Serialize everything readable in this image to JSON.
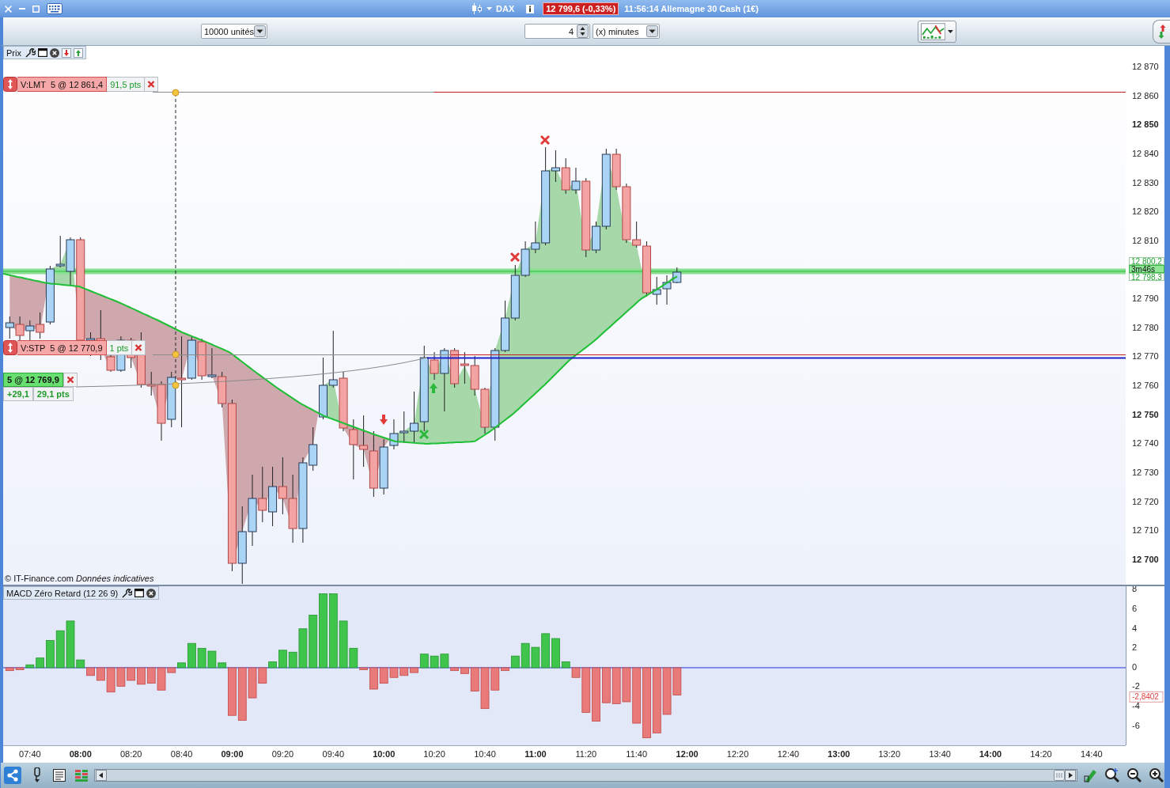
{
  "title_bar": {
    "instrument": "DAX",
    "price_badge": "12 799,6 (-0,33%)",
    "info": "11:56:14 Allemagne 30 Cash (1€)"
  },
  "toolbar": {
    "quantity": "10000 unités",
    "period": "4",
    "unit": "(x) minutes"
  },
  "price_panel": {
    "title": "Prix",
    "orders": [
      {
        "label": "V:LMT  5 @ 12 861,4",
        "distance": "91,5 pts"
      },
      {
        "label": "V:STP  5 @ 12 770,9",
        "distance": "1 pts"
      }
    ],
    "position": {
      "label": "5 @ 12 769,9",
      "gain": "+29,1",
      "points": "29,1 pts"
    },
    "axis": [
      {
        "kind": "tick",
        "label": "12 870",
        "major": false
      },
      {
        "kind": "tick",
        "label": "12 860",
        "major": false
      },
      {
        "kind": "tick",
        "label": "12 850",
        "major": true
      },
      {
        "kind": "tick",
        "label": "12 840",
        "major": false
      },
      {
        "kind": "tick",
        "label": "12 830",
        "major": false
      },
      {
        "kind": "tick",
        "label": "12 820",
        "major": false
      },
      {
        "kind": "tick",
        "label": "12 810",
        "major": false
      },
      {
        "kind": "tags",
        "tags": [
          {
            "kind": "price",
            "text": "12 800,2"
          },
          {
            "kind": "timer",
            "text": "3m46s"
          },
          {
            "kind": "price",
            "text": "12 798,3"
          }
        ]
      },
      {
        "kind": "tick",
        "label": "12 790",
        "major": false
      },
      {
        "kind": "tick",
        "label": "12 780",
        "major": false
      },
      {
        "kind": "tick",
        "label": "12 770",
        "major": false
      },
      {
        "kind": "tick",
        "label": "12 760",
        "major": false
      },
      {
        "kind": "tick",
        "label": "12 750",
        "major": true
      },
      {
        "kind": "tick",
        "label": "12 740",
        "major": false
      },
      {
        "kind": "tick",
        "label": "12 730",
        "major": false
      },
      {
        "kind": "tick",
        "label": "12 720",
        "major": false
      },
      {
        "kind": "tick",
        "label": "12 710",
        "major": false
      },
      {
        "kind": "tick",
        "label": "12 700",
        "major": true
      }
    ],
    "note": "© IT-Finance.com *Données indicatives*"
  },
  "macd_panel": {
    "value_tag": "-2,8402",
    "chart_data": {
      "type": "bar",
      "title": "MACD Zéro Retard (12 26 9)",
      "x": [
        452,
        456,
        460,
        464,
        468,
        472,
        476,
        480,
        484,
        488,
        492,
        496,
        500,
        504,
        508,
        512,
        516,
        520,
        524,
        528,
        532,
        536,
        540,
        544,
        548,
        552,
        556,
        560,
        564,
        568,
        572,
        576,
        580,
        584,
        588,
        592,
        596,
        600,
        604,
        608,
        612,
        616,
        620,
        624,
        628,
        632,
        636,
        640,
        644,
        648,
        652,
        656,
        660,
        664,
        668,
        672,
        676,
        680,
        684,
        688,
        692,
        696,
        700,
        704,
        708,
        712,
        716
      ],
      "values": [
        -0.3,
        -0.2,
        0.3,
        1,
        2.8,
        3.8,
        4.8,
        0.8,
        -0.8,
        -1.3,
        -2.5,
        -1.9,
        -1.3,
        -1.7,
        -1.6,
        -2.3,
        -0.5,
        0.5,
        2.5,
        2,
        1.7,
        0.5,
        -4.9,
        -5.4,
        -3.1,
        -1.6,
        0.6,
        1.8,
        1.6,
        4,
        5.4,
        7.6,
        7.6,
        4.8,
        2,
        -0.2,
        -2.2,
        -1.6,
        -1,
        -0.8,
        -0.5,
        1.4,
        1.2,
        1.4,
        -0.3,
        -0.6,
        -2.4,
        -4.2,
        -2.3,
        -0.3,
        1.2,
        2.5,
        2.1,
        3.5,
        3,
        0.6,
        -1,
        -4.6,
        -5.5,
        -3.6,
        -3.7,
        -3.5,
        -5.7,
        -7.2,
        -6.7,
        -4.8,
        -2.8
      ],
      "xlim": [
        449.4,
        893.5
      ],
      "ylim": [
        -7.97,
        8.37
      ],
      "xticks": [
        {
          "value": 460,
          "label": "07:40"
        },
        {
          "value": 480,
          "label": "08:00"
        },
        {
          "value": 500,
          "label": "08:20"
        },
        {
          "value": 520,
          "label": "08:40"
        },
        {
          "value": 540,
          "label": "09:00"
        },
        {
          "value": 560,
          "label": "09:20"
        },
        {
          "value": 580,
          "label": "09:40"
        },
        {
          "value": 600,
          "label": "10:00"
        },
        {
          "value": 620,
          "label": "10:20"
        },
        {
          "value": 640,
          "label": "10:40"
        },
        {
          "value": 660,
          "label": "11:00"
        },
        {
          "value": 680,
          "label": "11:20"
        },
        {
          "value": 700,
          "label": "11:40"
        },
        {
          "value": 720,
          "label": "12:00"
        },
        {
          "value": 740,
          "label": "12:20"
        },
        {
          "value": 760,
          "label": "12:40"
        },
        {
          "value": 780,
          "label": "13:00"
        },
        {
          "value": 800,
          "label": "13:20"
        },
        {
          "value": 820,
          "label": "13:40"
        },
        {
          "value": 840,
          "label": "14:00"
        },
        {
          "value": 860,
          "label": "14:20"
        },
        {
          "value": 880,
          "label": "14:40"
        }
      ],
      "yticks": [
        8,
        6,
        4,
        2,
        0,
        -2,
        -4,
        -6
      ],
      "ref_lines": [
        {
          "axis": "y",
          "value": 0
        }
      ]
    }
  }
}
